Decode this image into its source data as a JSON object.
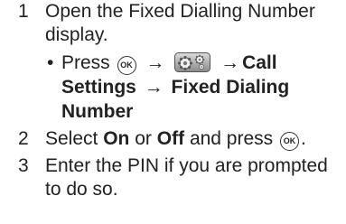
{
  "steps": [
    {
      "number": "1",
      "text": "Open the Fixed Dialling Number display.",
      "substep": {
        "bullet": "•",
        "press": "Press",
        "ok_key": "OK",
        "arrow_1": "→",
        "arrow_2": "→",
        "call_settings": "Call Settings",
        "arrow_3": "→",
        "fixed_dialing_number": "Fixed Dialing Number",
        "icon": "settings-gear-icon"
      }
    },
    {
      "number": "2",
      "select": "Select",
      "on": "On",
      "or": "or",
      "off": "Off",
      "and_press": "and press",
      "ok_key": "OK",
      "period": "."
    },
    {
      "number": "3",
      "text": "Enter the PIN if you are prompted to do so."
    }
  ]
}
